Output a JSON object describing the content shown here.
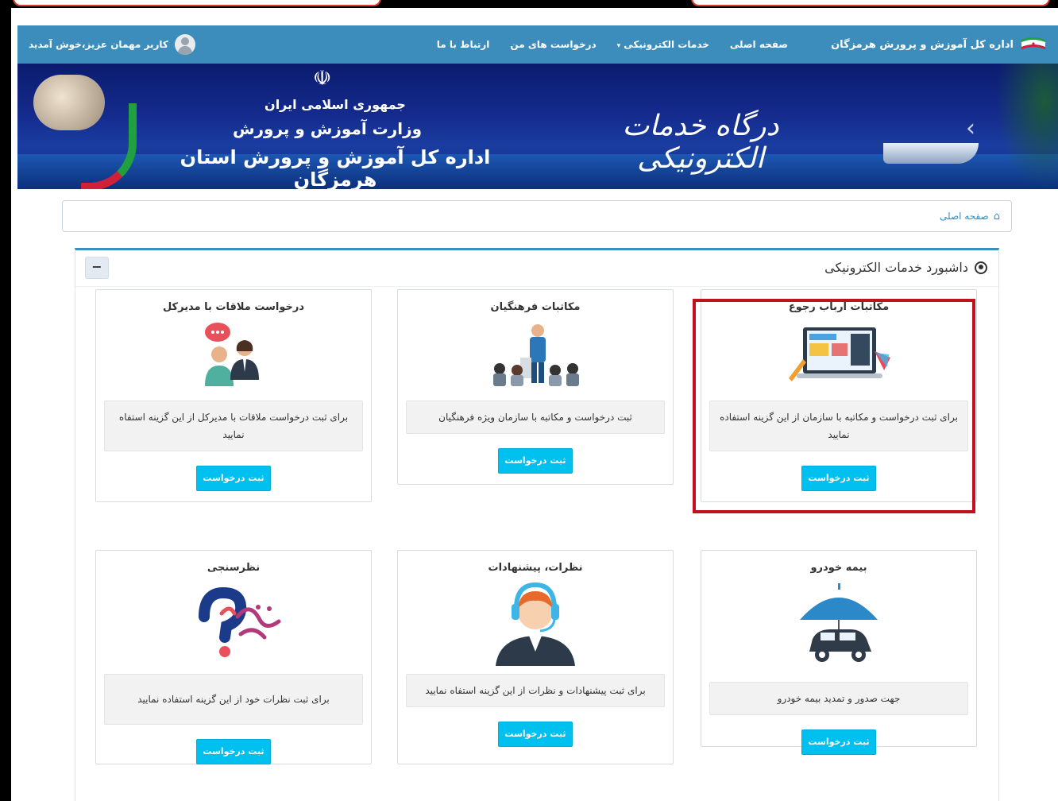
{
  "navbar": {
    "brand": "اداره کل آموزش و پرورش هرمزگان",
    "links": [
      {
        "label": "صفحه اصلی"
      },
      {
        "label": "خدمات الکترونیکی",
        "caret": "▾"
      },
      {
        "label": "درخواست های من"
      },
      {
        "label": "ارتباط با ما"
      }
    ],
    "user_greeting": "کاربر مهمان عزیز،خوش آمدید"
  },
  "banner": {
    "emblem": "☫",
    "line1": "جمهوری اسلامی ایران",
    "line2": "وزارت آموزش و پرورش",
    "line3": "اداره کل آموزش و پرورش استان هرمزگان",
    "portal_title": "درگاه خدمات الکترونیکی",
    "nav_arrow": "‹"
  },
  "breadcrumb": {
    "home_label": "صفحه اصلی"
  },
  "dashboard": {
    "title": "داشبورد خدمات الکترونیکی",
    "collapse_label": "−",
    "cards": [
      {
        "title": "مکاتبات ارباب رجوع",
        "desc": "برای ثبت درخواست و مکاتبه با سازمان از این گزینه استفاده نمایید",
        "button": "ثبت درخواست",
        "icon": "laptop-design-icon"
      },
      {
        "title": "مکاتبات فرهنگیان",
        "desc": "ثبت درخواست و مکاتبه با سازمان ویژه فرهنگیان",
        "button": "ثبت درخواست",
        "icon": "presentation-icon"
      },
      {
        "title": "درخواست ملاقات با مدیرکل",
        "desc": "برای ثبت درخواست ملاقات با مدیرکل از این گزینه استفاه نمایید",
        "button": "ثبت درخواست",
        "icon": "meeting-chat-icon"
      },
      {
        "title": "بیمه خودرو",
        "desc": "جهت صدور و تمدید بیمه خودرو",
        "button": "ثبت درخواست",
        "icon": "car-insurance-icon"
      },
      {
        "title": "نظرات، پیشنهادات",
        "desc": "برای ثبت پیشنهادات و نظرات از این گزینه استفاه نمایید",
        "button": "ثبت درخواست",
        "icon": "support-agent-icon"
      },
      {
        "title": "نظرسنجی",
        "desc": "برای ثبت نظرات خود از این گزینه استفاده نمایید",
        "button": "ثبت درخواست",
        "icon": "survey-logo-icon"
      }
    ]
  },
  "colors": {
    "navbar": "#3c8dbc",
    "button": "#00c0ef",
    "highlight": "#c0111f"
  }
}
